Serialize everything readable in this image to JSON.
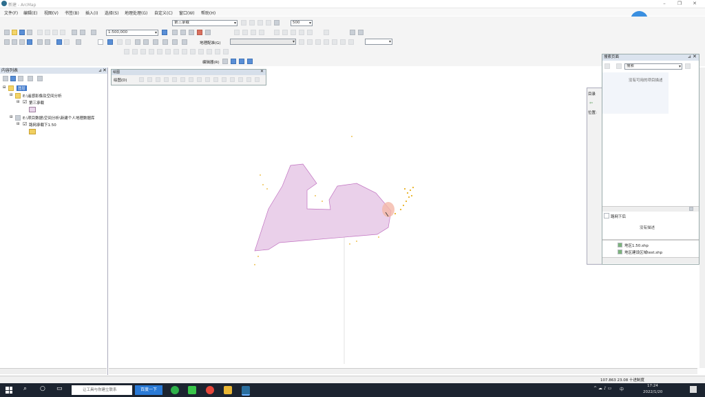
{
  "window": {
    "app_title": "ArcMap",
    "title_fragment": "新建 - ArcMap"
  },
  "menu": [
    "文件(F)",
    "编辑(E)",
    "视图(V)",
    "书签(B)",
    "插入(I)",
    "选择(S)",
    "地理处理(G)",
    "自定义(C)",
    "窗口(W)",
    "帮助(H)"
  ],
  "toolbar": {
    "scale": "1:500,000",
    "layer_select": "第三承载",
    "small_value": "500",
    "georef_label": "地理配准(G)",
    "editor_label": "编辑器(R)"
  },
  "float_toolbar": {
    "title": "绘图",
    "drawing_label": "绘图(D)"
  },
  "toc": {
    "title": "内容列表",
    "root_label": "图层",
    "items": [
      "E:\\遥感影像及空间分析",
      "第三承载",
      "E:\\项目数据\\空间分析\\新建个人地理数据库",
      "路网承载下1.50"
    ]
  },
  "catalog": {
    "title": "搜索页面",
    "search_placeholder": "搜索",
    "empty_hint": "没有可用的项目描述",
    "side_label_1": "目录",
    "side_label_2": "位置:",
    "lower_title": "路网下后",
    "lower_text": "没有描述",
    "files": [
      "地区1.50.shp",
      "地区建设区域test.shp"
    ]
  },
  "status": {
    "coords": "107.863 23.08 十进制度"
  },
  "taskbar": {
    "search_placeholder": "让工具与你建立联系",
    "search_button": "百度一下",
    "ime": "中",
    "time": "17:24",
    "date": "2022/1/20"
  },
  "colors": {
    "polygon_fill": "#ead0ea",
    "polygon_stroke": "#c070c0",
    "point_color": "#e8b020",
    "highlight": "#f4b8a8",
    "blue_ball": "#3a8fe0"
  }
}
